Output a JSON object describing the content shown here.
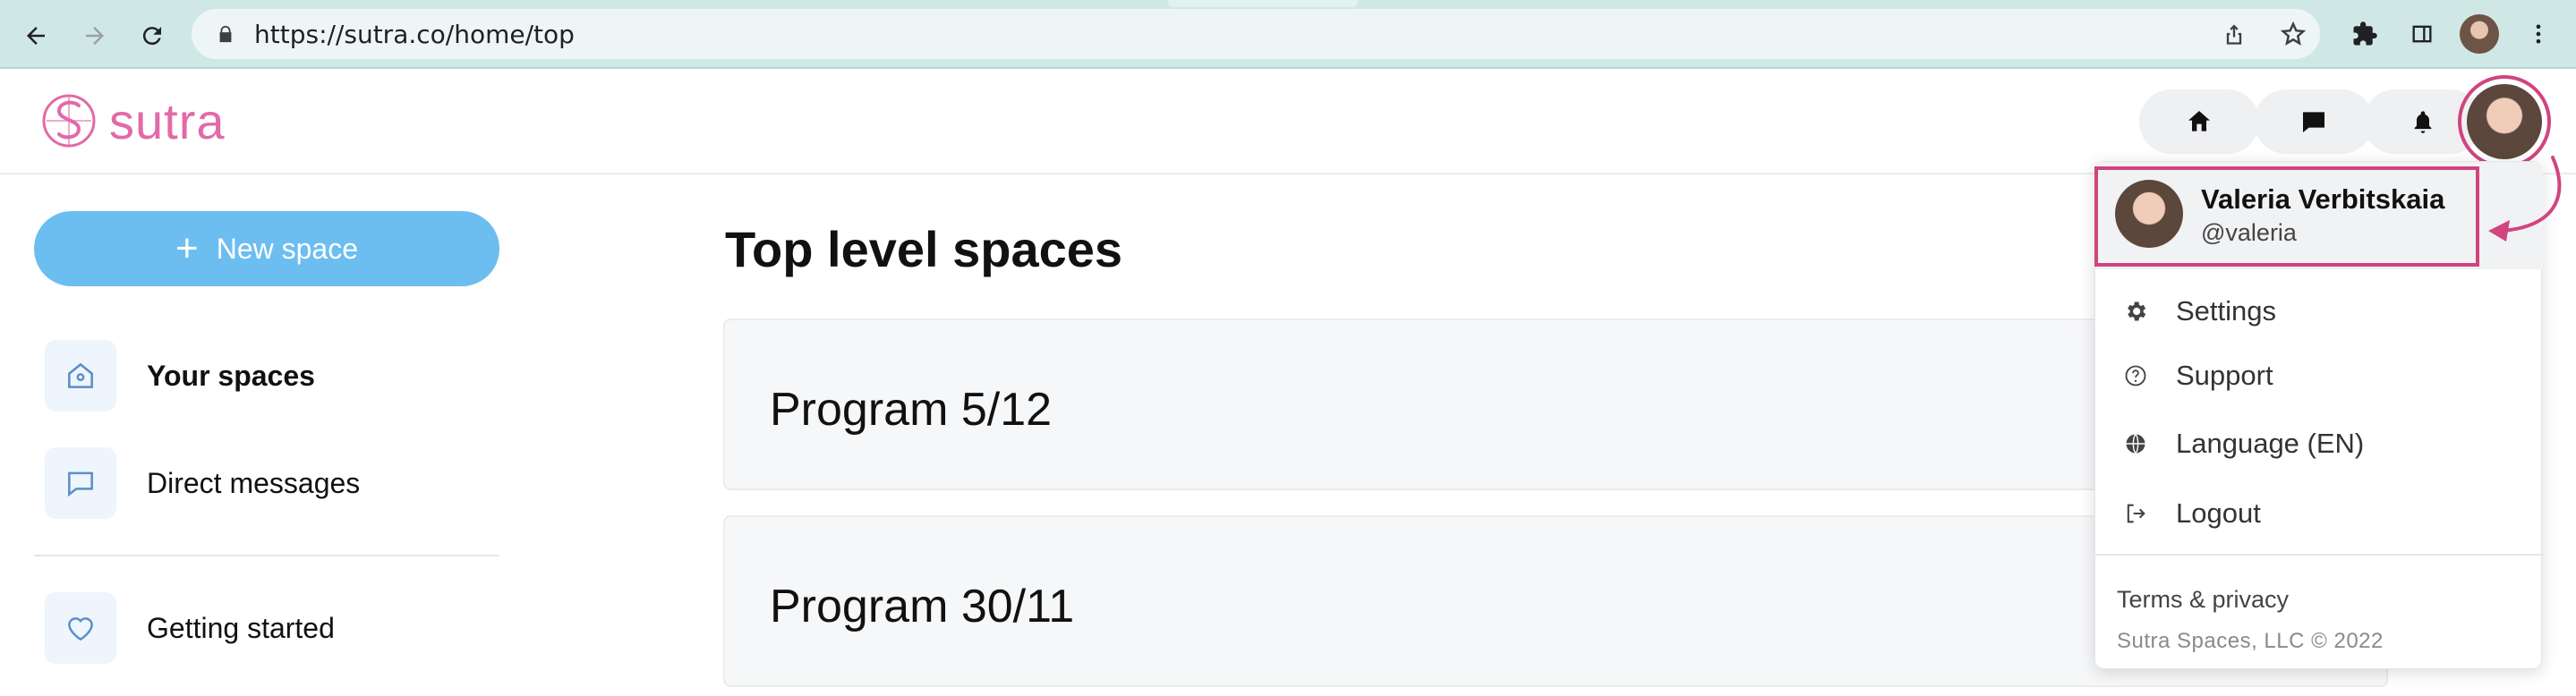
{
  "browser": {
    "url": "https://sutra.co/home/top",
    "icons": [
      "back-icon",
      "forward-icon",
      "reload-icon",
      "lock-icon",
      "share-icon",
      "star-icon",
      "extensions-icon",
      "sidepanel-icon",
      "profile-avatar",
      "kebab-menu-icon"
    ]
  },
  "header": {
    "logo_text": "sutra",
    "buttons": [
      "home-icon",
      "chat-icon",
      "bell-icon"
    ],
    "accent": "#e26aa8"
  },
  "sidebar": {
    "new_space_label": "New space",
    "items": [
      {
        "label": "Your spaces",
        "icon": "home-outline-icon",
        "active": true
      },
      {
        "label": "Direct messages",
        "icon": "message-icon"
      },
      {
        "label": "Getting started",
        "icon": "heart-icon"
      }
    ],
    "button_color": "#6cbef0"
  },
  "main": {
    "title": "Top level spaces",
    "spaces": [
      {
        "name": "Program 5/12"
      },
      {
        "name": "Program 30/11"
      }
    ]
  },
  "user_menu": {
    "name": "Valeria Verbitskaia",
    "handle": "@valeria",
    "items": [
      {
        "label": "Settings",
        "icon": "gear-icon"
      },
      {
        "label": "Support",
        "icon": "question-icon"
      },
      {
        "label": "Language (EN)",
        "icon": "globe-icon"
      },
      {
        "label": "Logout",
        "icon": "logout-icon"
      }
    ],
    "terms": "Terms & privacy",
    "copyright": "Sutra Spaces, LLC © 2022",
    "highlight_color": "#d1447f"
  }
}
